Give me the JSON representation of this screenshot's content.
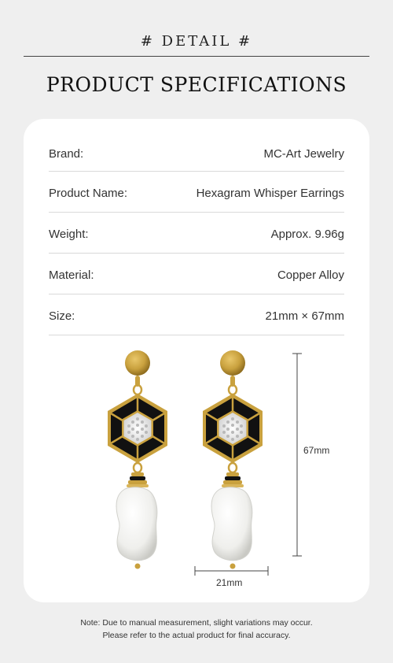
{
  "header": {
    "detail": "# DETAIL #",
    "title": "PRODUCT SPECIFICATIONS"
  },
  "specs": [
    {
      "label": "Brand:",
      "value": "MC-Art Jewelry"
    },
    {
      "label": "Product Name:",
      "value": "Hexagram Whisper Earrings"
    },
    {
      "label": "Weight:",
      "value": "Approx. 9.96g"
    },
    {
      "label": "Material:",
      "value": "Copper Alloy"
    },
    {
      "label": "Size:",
      "value": "21mm × 67mm"
    }
  ],
  "dimensions": {
    "height_label": "67mm",
    "width_label": "21mm"
  },
  "note": {
    "line1": "Note: Due to manual measurement, slight variations may occur.",
    "line2": "Please refer to the actual product for final accuracy."
  },
  "colors": {
    "background": "#efefef",
    "card": "#ffffff",
    "gold": "#c9a13e",
    "enamel": "#111111",
    "pearl": "#f3f3f1"
  }
}
